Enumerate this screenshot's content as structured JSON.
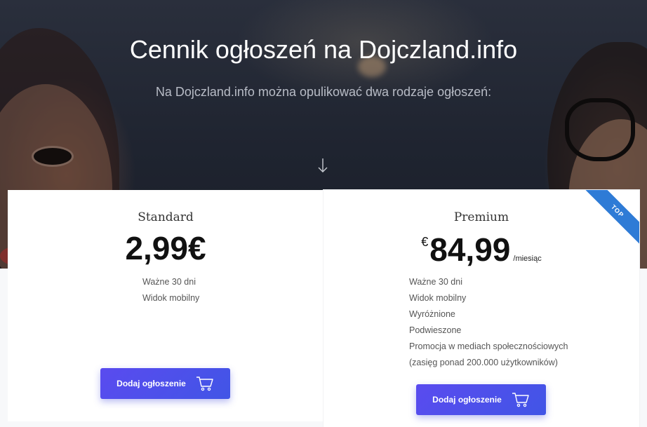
{
  "hero": {
    "title": "Cennik ogłoszeń na Dojczland.info",
    "subtitle": "Na Dojczland.info można opulikować dwa rodzaje ogłoszeń:"
  },
  "plans": [
    {
      "name": "Standard",
      "price": "2,99€",
      "features": [
        "Ważne 30 dni",
        "Widok mobilny"
      ],
      "button_label": "Dodaj ogłoszenie"
    },
    {
      "name": "Premium",
      "currency": "€",
      "price": "84,99",
      "period": "/miesiąc",
      "badge": "TOP",
      "features": [
        "Ważne 30 dni",
        "Widok mobilny",
        "Wyróżnione",
        "Podwieszone",
        "Promocja w mediach społecznościowych",
        "(zasięg ponad 200.000 użytkowników)"
      ],
      "button_label": "Dodaj ogłoszenie"
    }
  ],
  "icons": {
    "scroll_down": "arrow-down-icon",
    "cart": "cart-icon"
  },
  "colors": {
    "button": "#4d50ea",
    "ribbon": "#2e7bd6"
  }
}
